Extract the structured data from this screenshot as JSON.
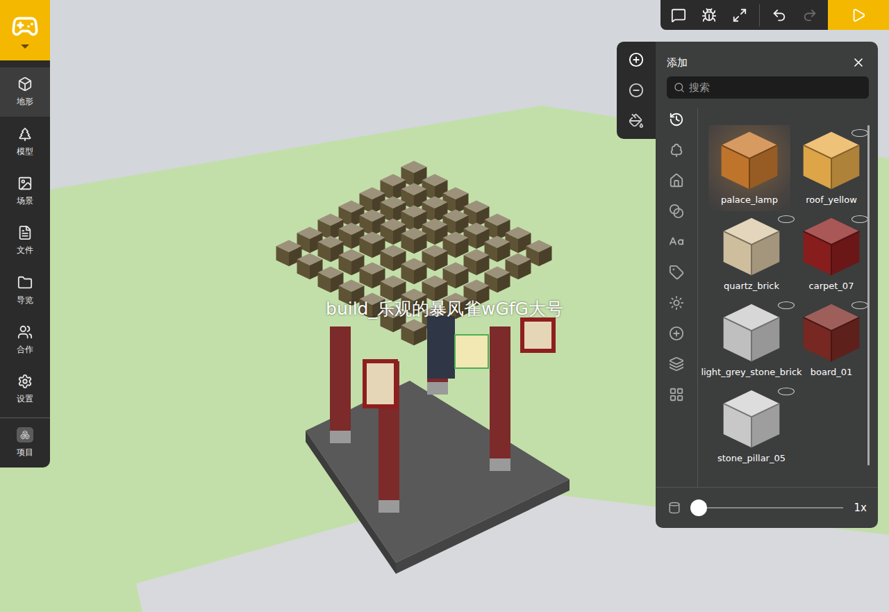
{
  "sidebar": {
    "items": [
      {
        "label": "地形",
        "selected": true
      },
      {
        "label": "模型",
        "selected": false
      },
      {
        "label": "场景",
        "selected": false
      },
      {
        "label": "文件",
        "selected": false
      },
      {
        "label": "导览",
        "selected": false
      },
      {
        "label": "合作",
        "selected": false
      },
      {
        "label": "设置",
        "selected": false
      }
    ],
    "project": {
      "label": "项目"
    }
  },
  "toolbar": {
    "buttons": [
      {
        "disabled": false
      },
      {
        "disabled": false
      },
      {
        "disabled": false
      },
      {
        "disabled": false
      },
      {
        "disabled": true
      }
    ]
  },
  "scene": {
    "player_name": "build_乐观的暴风雀wGfG大号"
  },
  "panel": {
    "title": "添加",
    "search": {
      "placeholder": "搜索"
    },
    "modes": [
      {
        "selected": true
      },
      {
        "selected": false
      },
      {
        "selected": false
      }
    ],
    "categories": [
      {
        "selected": true
      },
      {
        "selected": false
      },
      {
        "selected": false
      },
      {
        "selected": false
      },
      {
        "selected": false
      },
      {
        "selected": false
      },
      {
        "selected": false
      },
      {
        "selected": false
      },
      {
        "selected": false
      },
      {
        "selected": false
      }
    ],
    "blocks": [
      {
        "name": "palace_lamp",
        "selected": true,
        "color": "#c97a2e"
      },
      {
        "name": "roof_yellow",
        "selected": false,
        "color": "#e9ad4c"
      },
      {
        "name": "quartz_brick",
        "selected": false,
        "color": "#d9c8a6"
      },
      {
        "name": "carpet_07",
        "selected": false,
        "color": "#8e1f1f"
      },
      {
        "name": "light_grey_stone_brick",
        "selected": false,
        "color": "#c9c9c9"
      },
      {
        "name": "board_01",
        "selected": false,
        "color": "#7d2a24"
      },
      {
        "name": "stone_pillar_05",
        "selected": false,
        "color": "#d2d2d2"
      }
    ],
    "slider": {
      "level": 0,
      "reading": "1x"
    }
  }
}
